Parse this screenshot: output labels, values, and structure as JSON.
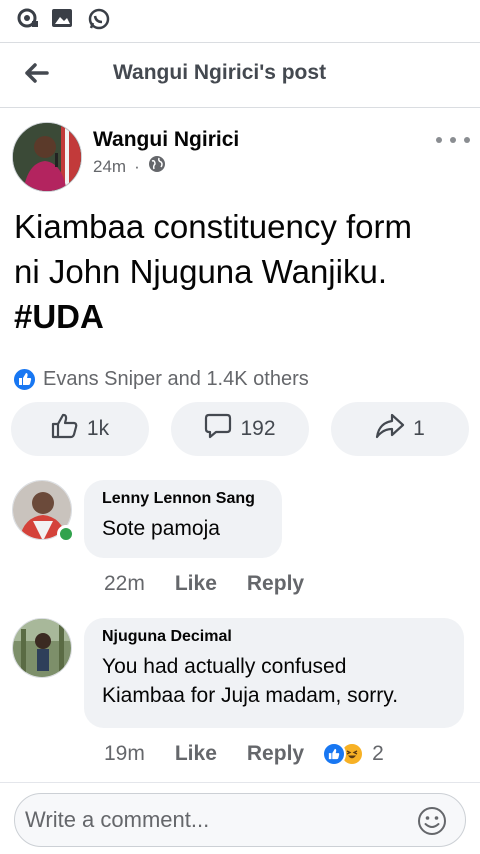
{
  "header": {
    "title": "Wangui Ngirici's post"
  },
  "post": {
    "author": "Wangui Ngirici",
    "time": "24m",
    "separator": "·",
    "text_line1": "Kiambaa constituency form",
    "text_line2": "ni John Njuguna Wanjiku.",
    "hashtag": "#UDA",
    "reactions_summary": "Evans Sniper and 1.4K others",
    "actions": {
      "like_count": "1k",
      "comment_count": "192",
      "share_count": "1"
    }
  },
  "comments": [
    {
      "author": "Lenny Lennon Sang",
      "text": "Sote pamoja",
      "time": "22m",
      "like_label": "Like",
      "reply_label": "Reply"
    },
    {
      "author": "Njuguna Decimal",
      "text_line1": "You had actually confused",
      "text_line2": "Kiambaa for Juja madam, sorry.",
      "time": "19m",
      "like_label": "Like",
      "reply_label": "Reply",
      "reaction_count": "2"
    }
  ],
  "composer": {
    "placeholder": "Write a comment..."
  },
  "colors": {
    "brand_blue": "#1877f2",
    "bubble_bg": "#f0f2f5",
    "secondary_text": "#65676b",
    "online_green": "#31a24c",
    "haha_yellow": "#f7b125"
  },
  "icons": {
    "status_bar": [
      "sync-icon",
      "image-icon",
      "whatsapp-icon"
    ],
    "header": "back-arrow-icon",
    "post_meta": "globe-icon",
    "post_menu": "more-options-icon",
    "actions": [
      "thumbs-up-icon",
      "comment-icon",
      "share-icon"
    ],
    "composer": "emoji-icon"
  }
}
